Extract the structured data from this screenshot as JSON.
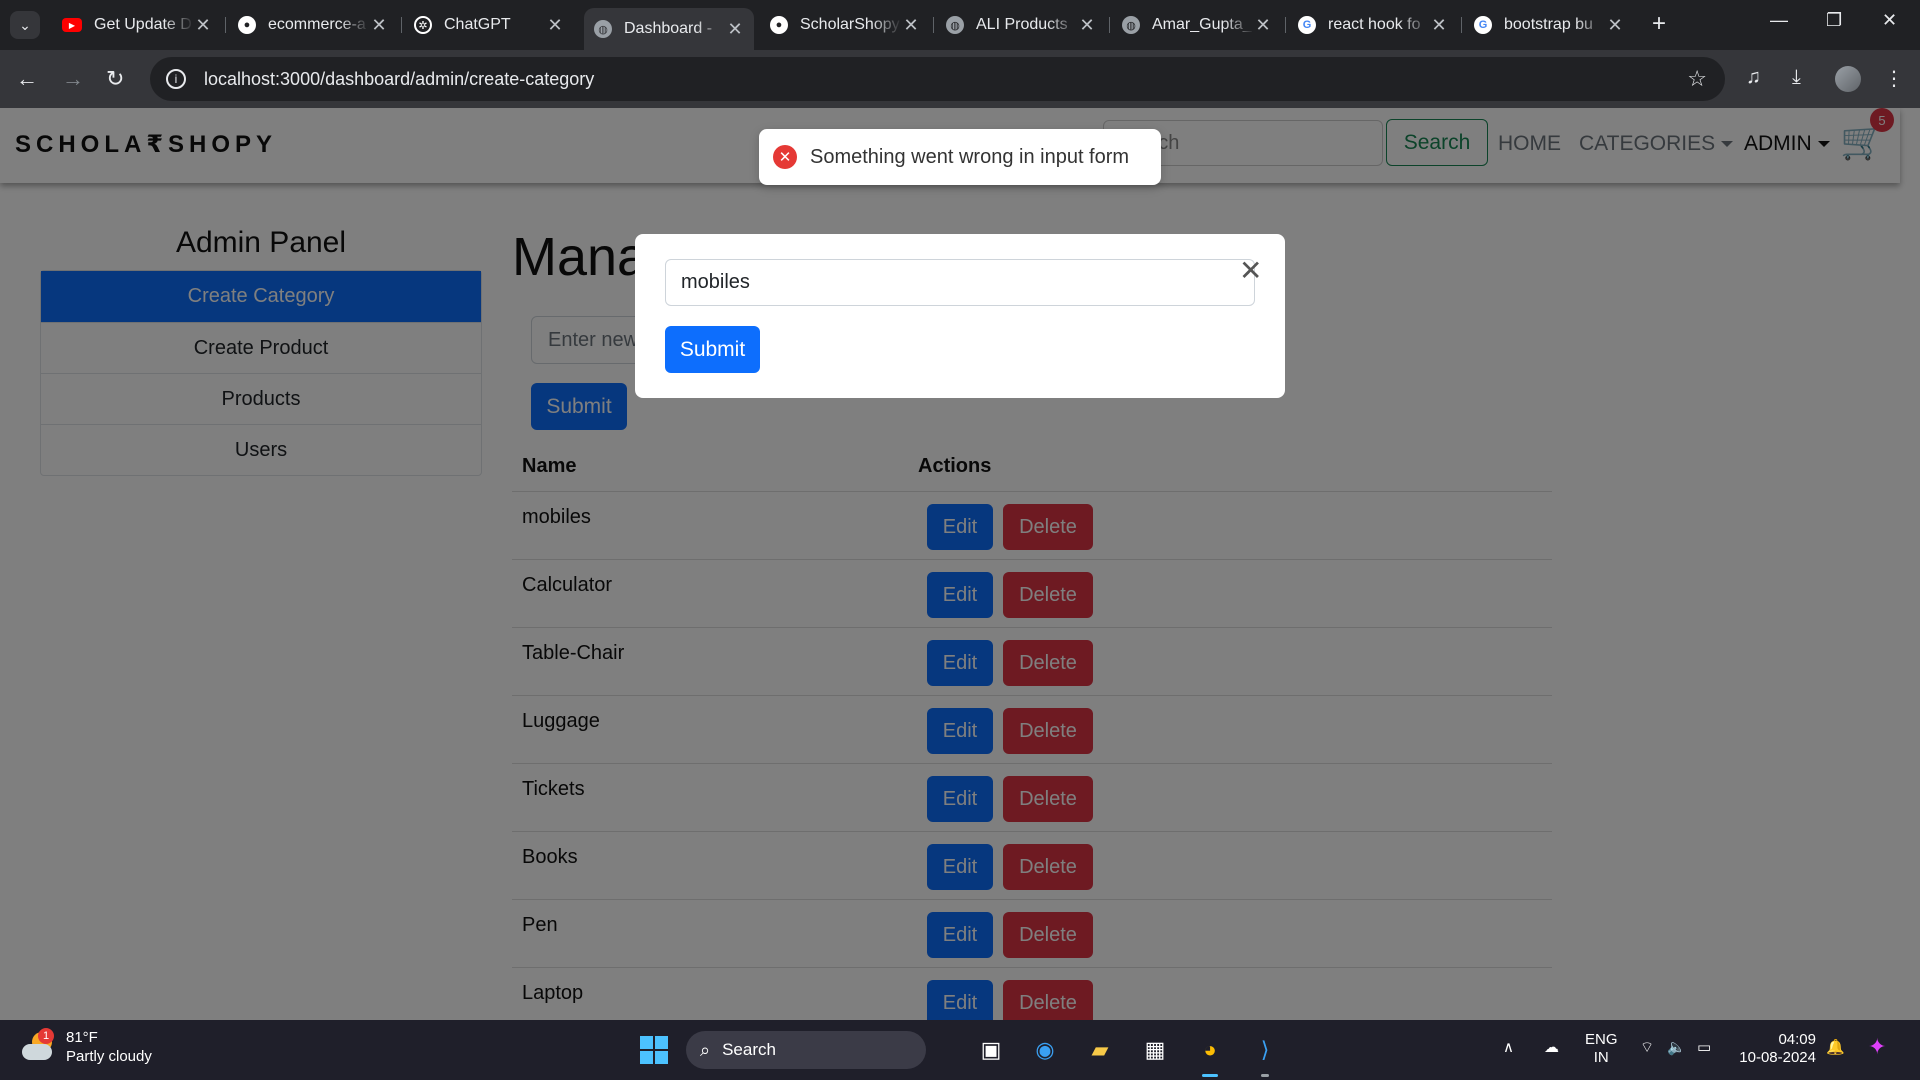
{
  "browser": {
    "tabs": [
      {
        "title": "Get Update D",
        "favicon": "youtube-icon",
        "color": "#ff0000"
      },
      {
        "title": "ecommerce-a",
        "favicon": "github-icon",
        "color": "#ffffff"
      },
      {
        "title": "ChatGPT",
        "favicon": "chatgpt-icon",
        "color": "#ffffff"
      },
      {
        "title": "Dashboard - ",
        "favicon": "globe-icon",
        "color": "#9aa0a6"
      },
      {
        "title": "ScholarShopy",
        "favicon": "github-icon",
        "color": "#ffffff"
      },
      {
        "title": "ALI Products",
        "favicon": "globe-icon",
        "color": "#9aa0a6"
      },
      {
        "title": "Amar_Gupta_",
        "favicon": "globe-icon",
        "color": "#9aa0a6"
      },
      {
        "title": "react hook fo",
        "favicon": "google-icon",
        "color": "#ffffff"
      },
      {
        "title": "bootstrap bu",
        "favicon": "google-icon",
        "color": "#ffffff"
      }
    ],
    "active_tab": 3,
    "url": "localhost:3000/dashboard/admin/create-category"
  },
  "site": {
    "brand": "SCHOLA₹SHOPY",
    "search_placeholder": "Search",
    "search_button": "Search",
    "nav": {
      "home": "HOME",
      "categories": "CATEGORIES",
      "admin": "ADMIN"
    },
    "cart_count": "5"
  },
  "sidebar": {
    "title": "Admin Panel",
    "items": [
      {
        "label": "Create Category",
        "active": true
      },
      {
        "label": "Create Product"
      },
      {
        "label": "Products"
      },
      {
        "label": "Users"
      }
    ]
  },
  "main": {
    "heading": "Manage Category",
    "new_category_placeholder": "Enter new category",
    "submit_label": "Submit",
    "table": {
      "headers": [
        "Name",
        "Actions"
      ],
      "rows": [
        "mobiles",
        "Calculator",
        "Table-Chair",
        "Luggage",
        "Tickets",
        "Books",
        "Pen",
        "Laptop"
      ],
      "edit_label": "Edit",
      "delete_label": "Delete"
    }
  },
  "modal": {
    "input_value": "mobiles",
    "submit_label": "Submit"
  },
  "toast": {
    "message": "Something went wrong in input form",
    "type": "error"
  },
  "taskbar": {
    "weather_temp": "81°F",
    "weather_desc": "Partly cloudy",
    "weather_badge": "1",
    "search_label": "Search",
    "lang_top": "ENG",
    "lang_bottom": "IN",
    "time": "04:09",
    "date": "10-08-2024"
  },
  "colors": {
    "primary": "#0d6efd",
    "danger": "#dc3545",
    "success": "#198754"
  }
}
